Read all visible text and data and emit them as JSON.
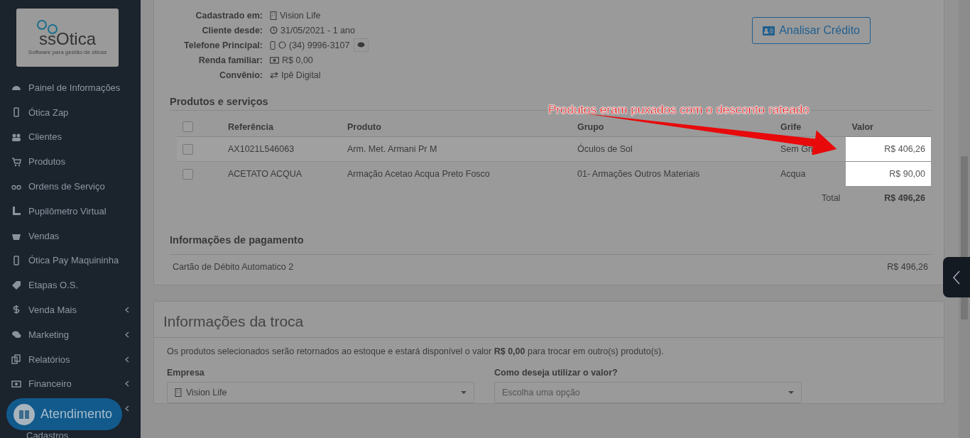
{
  "sidebar": {
    "logo": {
      "name": "ssOtica",
      "tagline": "Software para gestão de óticas"
    },
    "items": [
      {
        "label": "Painel de Informações",
        "submenu": false
      },
      {
        "label": "Ótica Zap",
        "submenu": false
      },
      {
        "label": "Clientes",
        "submenu": false
      },
      {
        "label": "Produtos",
        "submenu": false
      },
      {
        "label": "Ordens de Serviço",
        "submenu": false
      },
      {
        "label": "Pupilômetro Virtual",
        "submenu": false
      },
      {
        "label": "Vendas",
        "submenu": false
      },
      {
        "label": "Ótica Pay Maquininha",
        "submenu": false
      },
      {
        "label": "Etapas O.S.",
        "submenu": false
      },
      {
        "label": "Venda Mais",
        "submenu": true
      },
      {
        "label": "Marketing",
        "submenu": true
      },
      {
        "label": "Relatórios",
        "submenu": true
      },
      {
        "label": "Financeiro",
        "submenu": true
      }
    ],
    "cut_item": {
      "label": "Cadastros"
    },
    "support_button": {
      "label": "Atendimento"
    }
  },
  "client_info": [
    {
      "label": "Cadastrado em:",
      "value": "Vision Life"
    },
    {
      "label": "Cliente desde:",
      "value": "31/05/2021 - 1 ano"
    },
    {
      "label": "Telefone Principal:",
      "value": "(34) 9996-3107"
    },
    {
      "label": "Renda familiar:",
      "value": "R$ 0,00"
    },
    {
      "label": "Convênio:",
      "value": "Ipê Digital"
    }
  ],
  "credit_button": {
    "label": "Analisar Crédito"
  },
  "products": {
    "title": "Produtos e serviços",
    "all_checked": false,
    "columns": [
      "Referência",
      "Produto",
      "Grupo",
      "Grife",
      "Valor"
    ],
    "rows": [
      {
        "cells": [
          "AX1021L546063",
          "Arm. Met. Armani Pr M",
          "Óculos de Sol",
          "Sem Gri",
          "R$ 406,26"
        ],
        "checked": false,
        "highlighted": true
      },
      {
        "cells": [
          "ACETATO ACQUA",
          "Armação Acetao Acqua Preto Fosco",
          "01- Armações Outros Materiais",
          "Acqua",
          "R$ 90,00"
        ],
        "checked": false,
        "highlighted": true
      }
    ],
    "total_label": "Total",
    "total_value": "R$ 496,26"
  },
  "payment": {
    "title": "Informações de pagamento",
    "method": "Cartão de Débito Automatico 2",
    "amount": "R$ 496,26"
  },
  "annotation": {
    "text": "Produtos eram puxados com o desconto rateado"
  },
  "exchange": {
    "title": "Informações da troca",
    "description": "Os produtos selecionados serão retornados ao estoque e estará disponível o valor **R$ 0,00** para trocar em outro(s) produto(s).",
    "fields": [
      {
        "label": "Empresa",
        "value": "Vision Life"
      },
      {
        "label": "Como deseja utilizar o valor?",
        "placeholder": "Escolha uma opção"
      }
    ]
  }
}
